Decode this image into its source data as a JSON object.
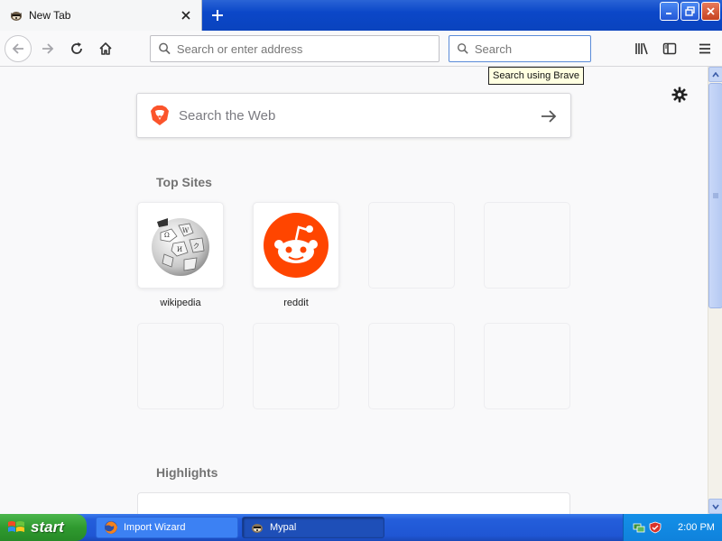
{
  "window": {
    "tab_title": "New Tab",
    "tab_favicon": "mypal-raccoon-icon"
  },
  "toolbar": {
    "url_placeholder": "Search or enter address",
    "search_placeholder": "Search",
    "search_tooltip": "Search using Brave"
  },
  "newtab": {
    "websearch_placeholder": "Search the Web",
    "top_sites_title": "Top Sites",
    "highlights_title": "Highlights",
    "top_sites": [
      {
        "label": "wikipedia",
        "icon": "wikipedia-globe-icon"
      },
      {
        "label": "reddit",
        "icon": "reddit-alien-icon"
      }
    ]
  },
  "taskbar": {
    "start_label": "start",
    "items": [
      {
        "label": "Import Wizard"
      },
      {
        "label": "Mypal"
      }
    ],
    "clock": "2:00 PM"
  },
  "colors": {
    "brave_orange": "#fb542b",
    "reddit_orange": "#ff4500",
    "xp_blue": "#0b47c8",
    "xp_green": "#2f9a2f"
  }
}
